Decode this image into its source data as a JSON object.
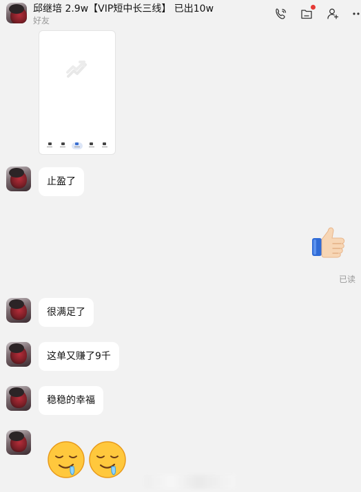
{
  "header": {
    "title": "邱继培 2.9w【VIP短中长三线】 已出10w",
    "subtitle": "好友",
    "icons": [
      "voice-call-icon",
      "chat-record-icon",
      "add-member-icon",
      "more-icon"
    ],
    "notification_color": "#e53935"
  },
  "image_card": {
    "dock_labels": [
      "",
      "",
      "",
      "",
      ""
    ]
  },
  "messages": [
    {
      "from": "friend",
      "text": "止盈了"
    },
    {
      "from": "self",
      "emoji": "thumbs-up"
    },
    {
      "from": "friend",
      "text": "很满足了"
    },
    {
      "from": "friend",
      "text": "这单又赚了9千"
    },
    {
      "from": "friend",
      "text": "稳稳的幸福"
    },
    {
      "from": "friend",
      "emoji": "drooling-face x2"
    }
  ],
  "read_status": "已读"
}
